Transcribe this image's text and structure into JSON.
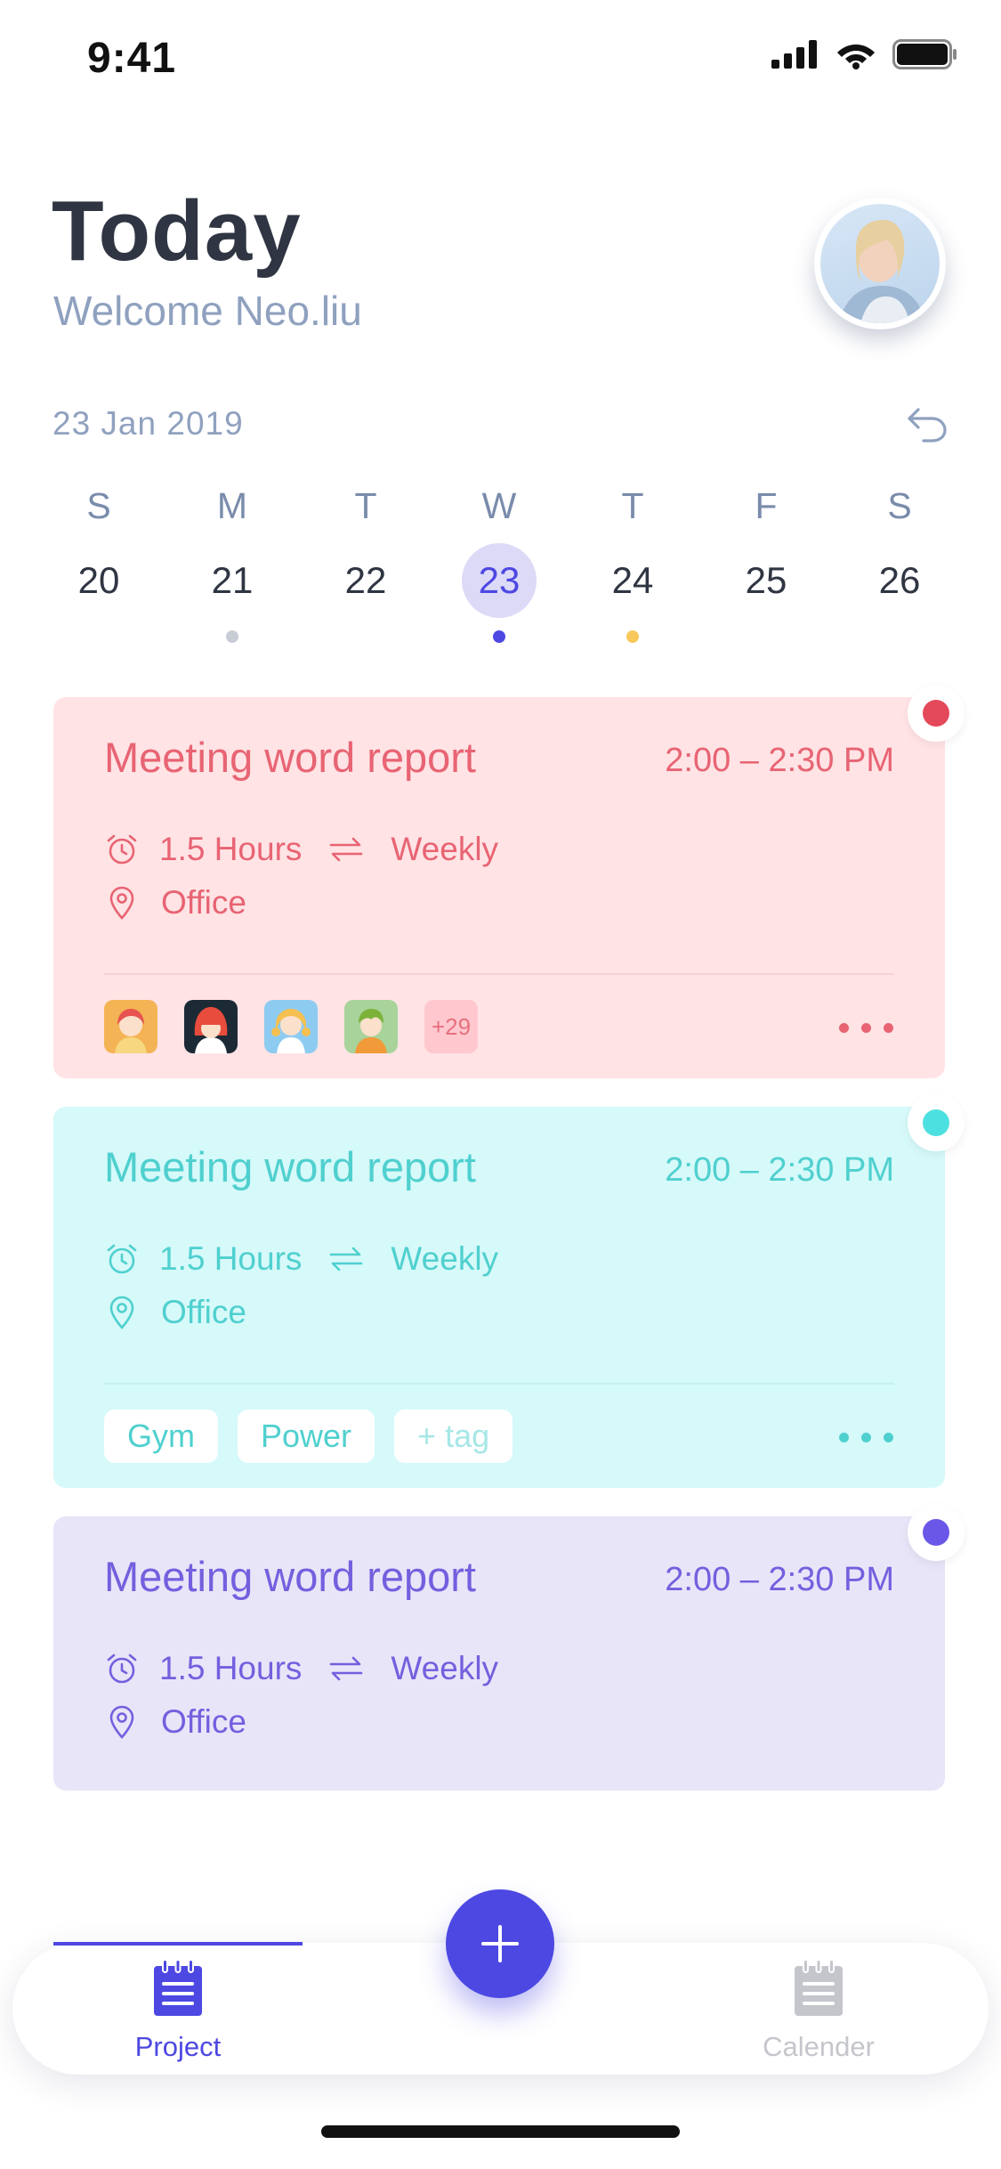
{
  "status_bar": {
    "time": "9:41",
    "icons": [
      "signal-icon",
      "wifi-icon",
      "battery-icon"
    ]
  },
  "header": {
    "title": "Today",
    "subtitle": "Welcome Neo.liu",
    "avatar": "profile-avatar"
  },
  "calendar": {
    "current_date": "23 Jan 2019",
    "days": [
      {
        "name": "S",
        "date": "20",
        "dot": null
      },
      {
        "name": "M",
        "date": "21",
        "dot": "#c8ccd4"
      },
      {
        "name": "T",
        "date": "22",
        "dot": null
      },
      {
        "name": "W",
        "date": "23",
        "dot": "#4d48e2",
        "selected": true
      },
      {
        "name": "T",
        "date": "24",
        "dot": "#f8c85a"
      },
      {
        "name": "F",
        "date": "25",
        "dot": null
      },
      {
        "name": "S",
        "date": "26",
        "dot": null
      }
    ]
  },
  "events": [
    {
      "title": "Meeting word report",
      "time": "2:00 – 2:30 PM",
      "duration": "1.5 Hours",
      "repeat": "Weekly",
      "location": "Office",
      "color": "#e86473",
      "dot_color": "#e4485b",
      "attendees_more": "+29"
    },
    {
      "title": "Meeting word report",
      "time": "2:00 – 2:30 PM",
      "duration": "1.5 Hours",
      "repeat": "Weekly",
      "location": "Office",
      "color": "#4fd0cf",
      "dot_color": "#4de0e0",
      "tags": [
        "Gym",
        "Power"
      ],
      "add_tag": "+ tag"
    },
    {
      "title": "Meeting word report",
      "time": "2:00 – 2:30 PM",
      "duration": "1.5 Hours",
      "repeat": "Weekly",
      "location": "Office",
      "color": "#7360de",
      "dot_color": "#6a57e8"
    }
  ],
  "tab_bar": {
    "project_label": "Project",
    "calendar_label": "Calender",
    "active_color": "#4d48e2",
    "inactive_color": "#c4c6cc"
  }
}
